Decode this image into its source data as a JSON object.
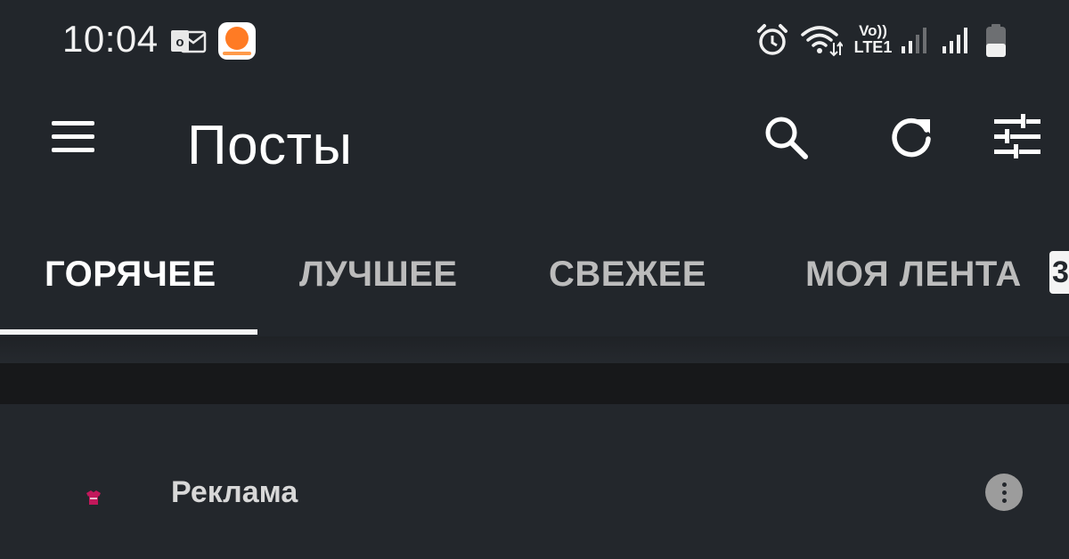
{
  "status_bar": {
    "time": "10:04",
    "notifications": [
      "outlook-icon",
      "orange-app-icon"
    ],
    "indicators": [
      "alarm-icon",
      "wifi-icon",
      "signal-icon",
      "signal-icon",
      "battery-icon"
    ],
    "volte_label": "Vo))",
    "network_label": "LTE1"
  },
  "app_bar": {
    "title": "Посты",
    "icons": [
      "menu-icon",
      "search-icon",
      "refresh-icon",
      "filter-icon"
    ]
  },
  "tabs": {
    "items": [
      {
        "label": "ГОРЯЧЕЕ",
        "active": true
      },
      {
        "label": "ЛУЧШЕЕ",
        "active": false
      },
      {
        "label": "СВЕЖЕЕ",
        "active": false
      },
      {
        "label": "МОЯ ЛЕНТА",
        "active": false
      }
    ],
    "badge": "3"
  },
  "post": {
    "label": "Реклама",
    "icon": "shirt-icon",
    "menu_icon": "more-vertical-icon"
  },
  "colors": {
    "background": "#22262b",
    "divider": "#17181a",
    "text_primary": "#ffffff",
    "text_secondary": "#bcbcbc",
    "accent_orange": "#ff7b24",
    "ad_icon": "#c2185b"
  }
}
